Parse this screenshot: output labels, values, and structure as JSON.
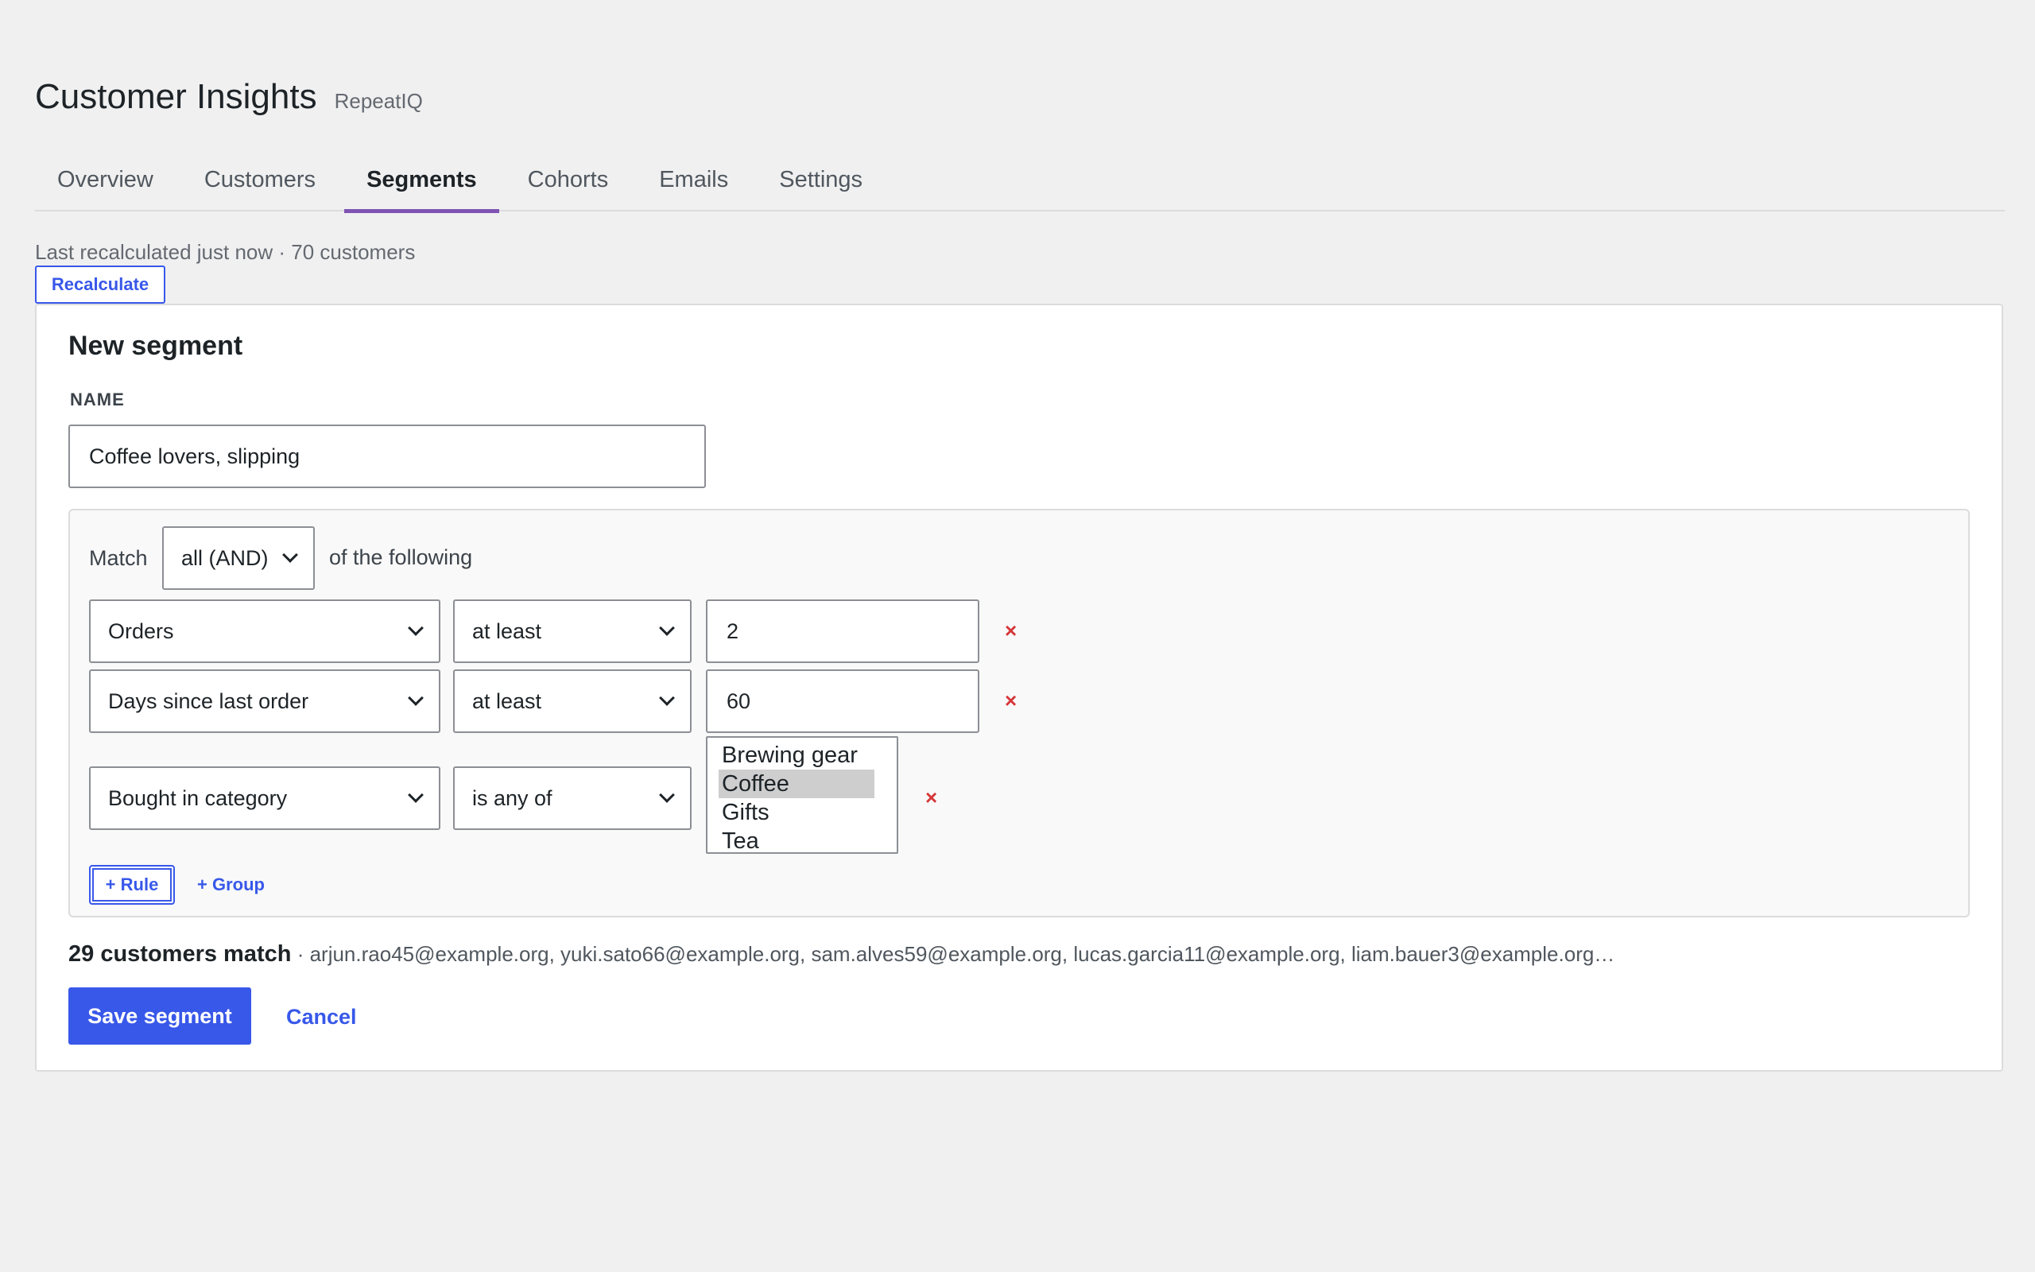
{
  "header": {
    "title": "Customer Insights",
    "subtitle": "RepeatIQ"
  },
  "tabs": [
    {
      "label": "Overview",
      "active": false
    },
    {
      "label": "Customers",
      "active": false
    },
    {
      "label": "Segments",
      "active": true
    },
    {
      "label": "Cohorts",
      "active": false
    },
    {
      "label": "Emails",
      "active": false
    },
    {
      "label": "Settings",
      "active": false
    }
  ],
  "status": {
    "text": "Last recalculated just now · 70 customers",
    "recalc_label": "Recalculate"
  },
  "segment": {
    "title": "New segment",
    "name_label": "NAME",
    "name_value": "Coffee lovers, slipping",
    "match": {
      "prefix": "Match",
      "value": "all (AND)",
      "suffix": "of the following"
    },
    "rules": [
      {
        "field": "Orders",
        "operator": "at least",
        "value": "2",
        "remove": "×"
      },
      {
        "field": "Days since last order",
        "operator": "at least",
        "value": "60",
        "remove": "×"
      },
      {
        "field": "Bought in category",
        "operator": "is any of",
        "options": [
          "Brewing gear",
          "Coffee",
          "Gifts",
          "Tea"
        ],
        "selected": "Coffee",
        "remove": "×"
      }
    ],
    "add_rule_label": "+ Rule",
    "add_group_label": "+ Group",
    "match_count": "29 customers match",
    "match_emails": " · arjun.rao45@example.org, yuki.sato66@example.org, sam.alves59@example.org, lucas.garcia11@example.org, liam.bauer3@example.org…",
    "save_label": "Save segment",
    "cancel_label": "Cancel"
  },
  "colors": {
    "accent": "#3858e9",
    "tab_underline": "#7f54b3",
    "remove": "#d63638"
  }
}
